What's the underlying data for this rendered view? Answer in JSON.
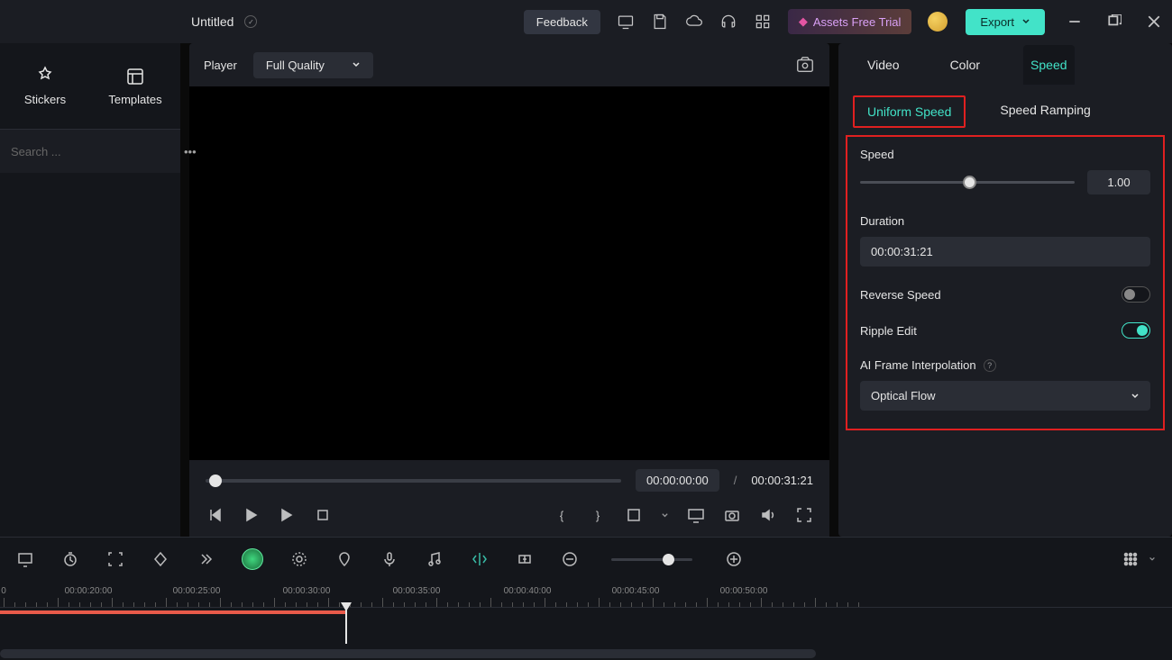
{
  "titlebar": {
    "title": "Untitled",
    "feedback": "Feedback",
    "trial": "Assets Free Trial",
    "export": "Export"
  },
  "left": {
    "stickers": "Stickers",
    "templates": "Templates",
    "search_ph": "Search ..."
  },
  "player": {
    "label": "Player",
    "quality": "Full Quality",
    "cur": "00:00:00:00",
    "sep": "/",
    "total": "00:00:31:21"
  },
  "props": {
    "tabs": {
      "video": "Video",
      "color": "Color",
      "speed": "Speed"
    },
    "sub": {
      "uniform": "Uniform Speed",
      "ramping": "Speed Ramping"
    },
    "speed": "Speed",
    "speed_val": "1.00",
    "duration": "Duration",
    "duration_val": "00:00:31:21",
    "reverse": "Reverse Speed",
    "ripple": "Ripple Edit",
    "interp": "AI Frame Interpolation",
    "interp_val": "Optical Flow"
  },
  "timeline": {
    "t0": "0",
    "t1": "00:00:20:00",
    "t2": "00:00:25:00",
    "t3": "00:00:30:00",
    "t4": "00:00:35:00",
    "t5": "00:00:40:00",
    "t6": "00:00:45:00",
    "t7": "00:00:50:00"
  }
}
